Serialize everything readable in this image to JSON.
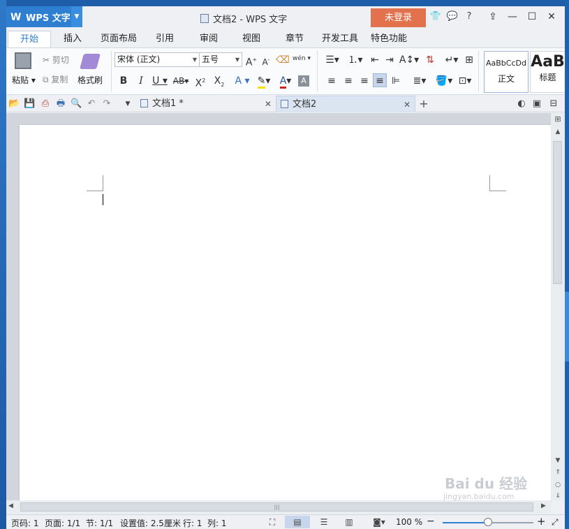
{
  "app": {
    "name": "WPS 文字",
    "logo": "W",
    "doc_title": "文档2 - WPS 文字",
    "login_label": "未登录",
    "help_label": "?"
  },
  "menu": [
    "开始",
    "插入",
    "页面布局",
    "引用",
    "审阅",
    "视图",
    "章节",
    "开发工具",
    "特色功能"
  ],
  "ribbon": {
    "paste": "粘贴",
    "cut": "剪切",
    "copy": "复制",
    "format_painter": "格式刷",
    "font_name": "宋体 (正文)",
    "font_size": "五号",
    "pinyin": "wén",
    "style_preview_1": "AaBbCcDd",
    "style_label_1": "正文",
    "style_preview_2": "AaB",
    "style_label_2": "标题"
  },
  "tabs": [
    {
      "label": "文档1 *",
      "active": false
    },
    {
      "label": "文档2",
      "active": true
    }
  ],
  "status": {
    "page_code": "页码: 1",
    "page": "页面: 1/1",
    "section": "节: 1/1",
    "setting": "设置值: 2.5厘米",
    "row": "行: 1",
    "col": "列: 1",
    "zoom": "100 %"
  },
  "zoom_level": 0.5,
  "watermark": {
    "text": "Bai du 经验",
    "url": "jingyan.baidu.com"
  },
  "colors": {
    "accent": "#2e7fd1",
    "login": "#e2714e",
    "highlight": "#f2e200",
    "font_color": "#d0201a"
  }
}
